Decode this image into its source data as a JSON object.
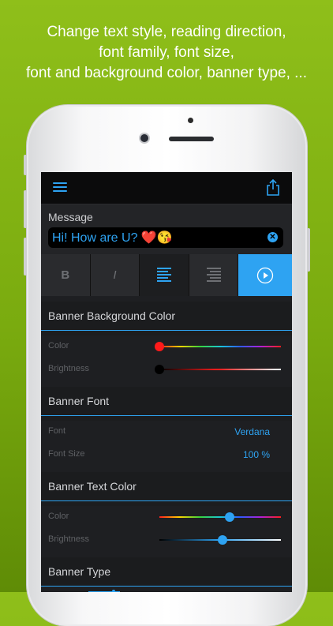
{
  "promo": {
    "line1": "Change text style, reading direction,",
    "line2": "font family, font size,",
    "line3": "font and background color, banner type, ..."
  },
  "toolbar": {
    "menu_icon": "hamburger-menu-icon",
    "share_icon": "share-icon"
  },
  "message": {
    "label": "Message",
    "value": "Hi! How are U? ❤️😘",
    "clear_icon": "clear-icon"
  },
  "format_buttons": [
    {
      "label": "B",
      "name": "bold"
    },
    {
      "label": "I",
      "name": "italic"
    },
    {
      "icon": "align-left-icon"
    },
    {
      "icon": "align-right-icon"
    },
    {
      "icon": "play-icon"
    }
  ],
  "banner_background_color": {
    "title": "Banner Background Color",
    "color_label": "Color",
    "color_level": 0.0,
    "brightness_label": "Brightness",
    "brightness_level": 0.0
  },
  "banner_font": {
    "title": "Banner Font",
    "font_label": "Font",
    "font_value": "Verdana",
    "size_label": "Font Size",
    "size_value": "100 %"
  },
  "banner_text_color": {
    "title": "Banner Text Color",
    "color_label": "Color",
    "color_level": 0.58,
    "brightness_label": "Brightness",
    "brightness_level": 0.52
  },
  "banner_type": {
    "title": "Banner Type"
  },
  "colors": {
    "accent": "#2ea3f2",
    "background": "#7aab0f",
    "screen": "#1c1d1f"
  }
}
